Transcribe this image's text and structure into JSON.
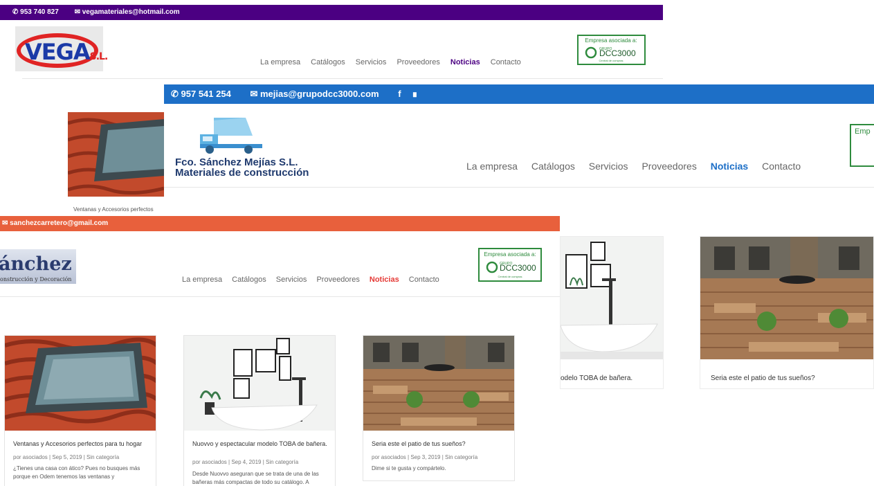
{
  "site1": {
    "phone": "953 740 827",
    "email": "vegamateriales@hotmail.com",
    "logo": {
      "word": "VEGA",
      "suffix": "S.L."
    },
    "nav": [
      "La empresa",
      "Catálogos",
      "Servicios",
      "Proveedores",
      "Noticias",
      "Contacto"
    ],
    "nav_active": "Noticias",
    "badge": {
      "line1": "Empresa asociada a:",
      "line2": "GRUPO",
      "line3": "DCC3000",
      "line4": "Central de compras"
    },
    "colors": {
      "topbar": "#4b0082",
      "accent": "#4b0082"
    }
  },
  "site2": {
    "phone": "957 541 254",
    "email": "mejias@grupodcc3000.com",
    "logo": {
      "line1": "Fco. Sánchez Mejías S.L.",
      "line2": "Materiales de construcción"
    },
    "nav": [
      "La empresa",
      "Catálogos",
      "Servicios",
      "Proveedores",
      "Noticias",
      "Contacto"
    ],
    "nav_active": "Noticias",
    "badge_partial": "Emp",
    "side_caption": "Ventanas y Accesorios perfectos",
    "card_bath_caption": "odelo TOBA de bañera.",
    "card_patio_caption": "Seria este el patio de tus sueños?",
    "colors": {
      "topbar": "#1d6fc7",
      "accent": "#1d6fc7"
    }
  },
  "site3": {
    "email": "sanchezcarretero@gmail.com",
    "logo": {
      "word": "ánchez",
      "sub": "onstrucción y Decoración"
    },
    "nav": [
      "La empresa",
      "Catálogos",
      "Servicios",
      "Proveedores",
      "Noticias",
      "Contacto"
    ],
    "nav_active": "Noticias",
    "badge": {
      "line1": "Empresa asociada a:",
      "line2": "GRUPO",
      "line3": "DCC3000",
      "line4": "Central de compras"
    },
    "colors": {
      "topbar": "#e8603c",
      "accent": "#e53935"
    },
    "posts": [
      {
        "title": "Ventanas y Accesorios perfectos para tu hogar",
        "meta": "por asociados | Sep 5, 2019 | Sin categoría",
        "excerpt": "¿Tienes una casa con ático? Pues no busques más porque en Odem tenemos las ventanas y"
      },
      {
        "title": "Nuovvo y espectacular modelo TOBA de bañera.",
        "meta": "por asociados | Sep 4, 2019 | Sin categoría",
        "excerpt": "Desde Nuovvo aseguran que se trata de una de las bañeras más compactas de todo su catálogo. A"
      },
      {
        "title": "Seria este el patio de tus sueños?",
        "meta": "por asociados | Sep 3, 2019 | Sin categoría",
        "excerpt": "Dime si te gusta y compártelo."
      }
    ]
  }
}
